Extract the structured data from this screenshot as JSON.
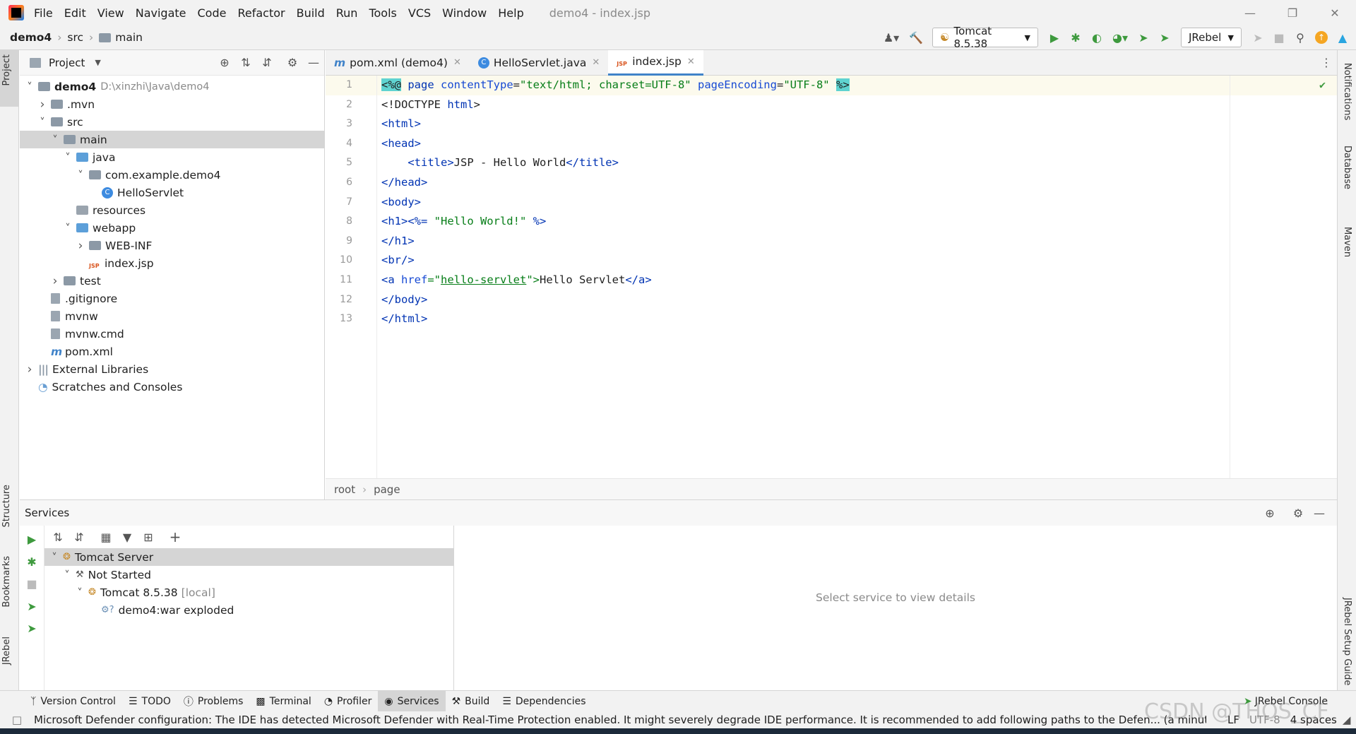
{
  "window": {
    "menu": [
      "File",
      "Edit",
      "View",
      "Navigate",
      "Code",
      "Refactor",
      "Build",
      "Run",
      "Tools",
      "VCS",
      "Window",
      "Help"
    ],
    "title": "demo4 - index.jsp"
  },
  "nav": {
    "crumbs": [
      "demo4",
      "src",
      "main"
    ],
    "run_config": "Tomcat 8.5.38",
    "jrebel": "JRebel"
  },
  "stripes": {
    "left": [
      "Project",
      "Structure",
      "Bookmarks",
      "JRebel"
    ],
    "right": [
      "Notifications",
      "Database",
      "Maven",
      "JRebel Setup Guide"
    ]
  },
  "project": {
    "header": "Project",
    "tree": [
      {
        "label": "demo4",
        "extra": "D:\\xinzhi\\Java\\demo4",
        "level": 0,
        "arrow": "v",
        "icon": "folder",
        "bold": true
      },
      {
        "label": ".mvn",
        "level": 1,
        "arrow": ">",
        "icon": "folder"
      },
      {
        "label": "src",
        "level": 1,
        "arrow": "v",
        "icon": "folder"
      },
      {
        "label": "main",
        "level": 2,
        "arrow": "v",
        "icon": "folder",
        "selected": true
      },
      {
        "label": "java",
        "level": 3,
        "arrow": "v",
        "icon": "folder-blue"
      },
      {
        "label": "com.example.demo4",
        "level": 4,
        "arrow": "v",
        "icon": "package"
      },
      {
        "label": "HelloServlet",
        "level": 5,
        "arrow": "",
        "icon": "class"
      },
      {
        "label": "resources",
        "level": 3,
        "arrow": "",
        "icon": "folder-res"
      },
      {
        "label": "webapp",
        "level": 3,
        "arrow": "v",
        "icon": "folder-blue"
      },
      {
        "label": "WEB-INF",
        "level": 4,
        "arrow": ">",
        "icon": "folder"
      },
      {
        "label": "index.jsp",
        "level": 4,
        "arrow": "",
        "icon": "jsp"
      },
      {
        "label": "test",
        "level": 2,
        "arrow": ">",
        "icon": "folder"
      },
      {
        "label": ".gitignore",
        "level": 1,
        "arrow": "",
        "icon": "file"
      },
      {
        "label": "mvnw",
        "level": 1,
        "arrow": "",
        "icon": "file"
      },
      {
        "label": "mvnw.cmd",
        "level": 1,
        "arrow": "",
        "icon": "file"
      },
      {
        "label": "pom.xml",
        "level": 1,
        "arrow": "",
        "icon": "maven"
      },
      {
        "label": "External Libraries",
        "level": 0,
        "arrow": ">",
        "icon": "libs"
      },
      {
        "label": "Scratches and Consoles",
        "level": 0,
        "arrow": "",
        "icon": "scratch"
      }
    ]
  },
  "editor": {
    "tabs": [
      {
        "label": "pom.xml (demo4)",
        "icon": "maven",
        "active": false
      },
      {
        "label": "HelloServlet.java",
        "icon": "class",
        "active": false
      },
      {
        "label": "index.jsp",
        "icon": "jsp",
        "active": true
      }
    ],
    "lines": [
      "1",
      "2",
      "3",
      "4",
      "5",
      "6",
      "7",
      "8",
      "9",
      "10",
      "11",
      "12",
      "13"
    ],
    "breadcrumb": [
      "root",
      "page"
    ],
    "code": {
      "l1": [
        "<%@",
        " page ",
        "contentType",
        "=",
        "\"text/html; charset=UTF-8\"",
        " ",
        "pageEncoding",
        "=",
        "\"UTF-8\"",
        " ",
        "%>"
      ],
      "l2": [
        "<!DOCTYPE ",
        "html",
        ">"
      ],
      "l3": [
        "<html>"
      ],
      "l4": [
        "<head>"
      ],
      "l5": [
        "    ",
        "<title>",
        "JSP - Hello World",
        "</title>"
      ],
      "l6": [
        "</head>"
      ],
      "l7": [
        "<body>"
      ],
      "l8": [
        "<h1>",
        "<%= ",
        "\"Hello World!\"",
        " %>"
      ],
      "l9": [
        "</h1>"
      ],
      "l10": [
        "<br/>"
      ],
      "l11": [
        "<a ",
        "href",
        "=\"",
        "hello-servlet",
        "\">",
        "Hello Servlet",
        "</a>"
      ],
      "l12": [
        "</body>"
      ],
      "l13": [
        "</html>"
      ]
    }
  },
  "services": {
    "title": "Services",
    "tree": [
      {
        "label": "Tomcat Server",
        "level": 0,
        "arrow": "v",
        "selected": true
      },
      {
        "label": "Not Started",
        "level": 1,
        "arrow": "v"
      },
      {
        "label": "Tomcat 8.5.38",
        "extra": "[local]",
        "level": 2,
        "arrow": "v"
      },
      {
        "label": "demo4:war exploded",
        "level": 3,
        "arrow": ""
      }
    ],
    "placeholder": "Select service to view details"
  },
  "toolwindows": [
    {
      "label": "Version Control",
      "icon": "branch-icon"
    },
    {
      "label": "TODO",
      "icon": "list-icon"
    },
    {
      "label": "Problems",
      "icon": "info-icon"
    },
    {
      "label": "Terminal",
      "icon": "terminal-icon"
    },
    {
      "label": "Profiler",
      "icon": "profiler-icon"
    },
    {
      "label": "Services",
      "icon": "services-icon",
      "active": true
    },
    {
      "label": "Build",
      "icon": "hammer-icon"
    },
    {
      "label": "Dependencies",
      "icon": "layers-icon"
    }
  ],
  "jrebel_console": "JRebel Console",
  "status": {
    "message": "Microsoft Defender configuration: The IDE has detected Microsoft Defender with Real-Time Protection enabled. It might severely degrade IDE performance. It is recommended to add following paths to the Defen... (a minute a",
    "line_sep": "LF",
    "encoding": "UTF-8",
    "indent": "4 spaces"
  },
  "watermark": "CSDN @THOS_CF",
  "colors": {
    "accent": "#4083c9",
    "tag": "#0033b3",
    "string": "#067d17",
    "selection": "#d5d5d5"
  }
}
